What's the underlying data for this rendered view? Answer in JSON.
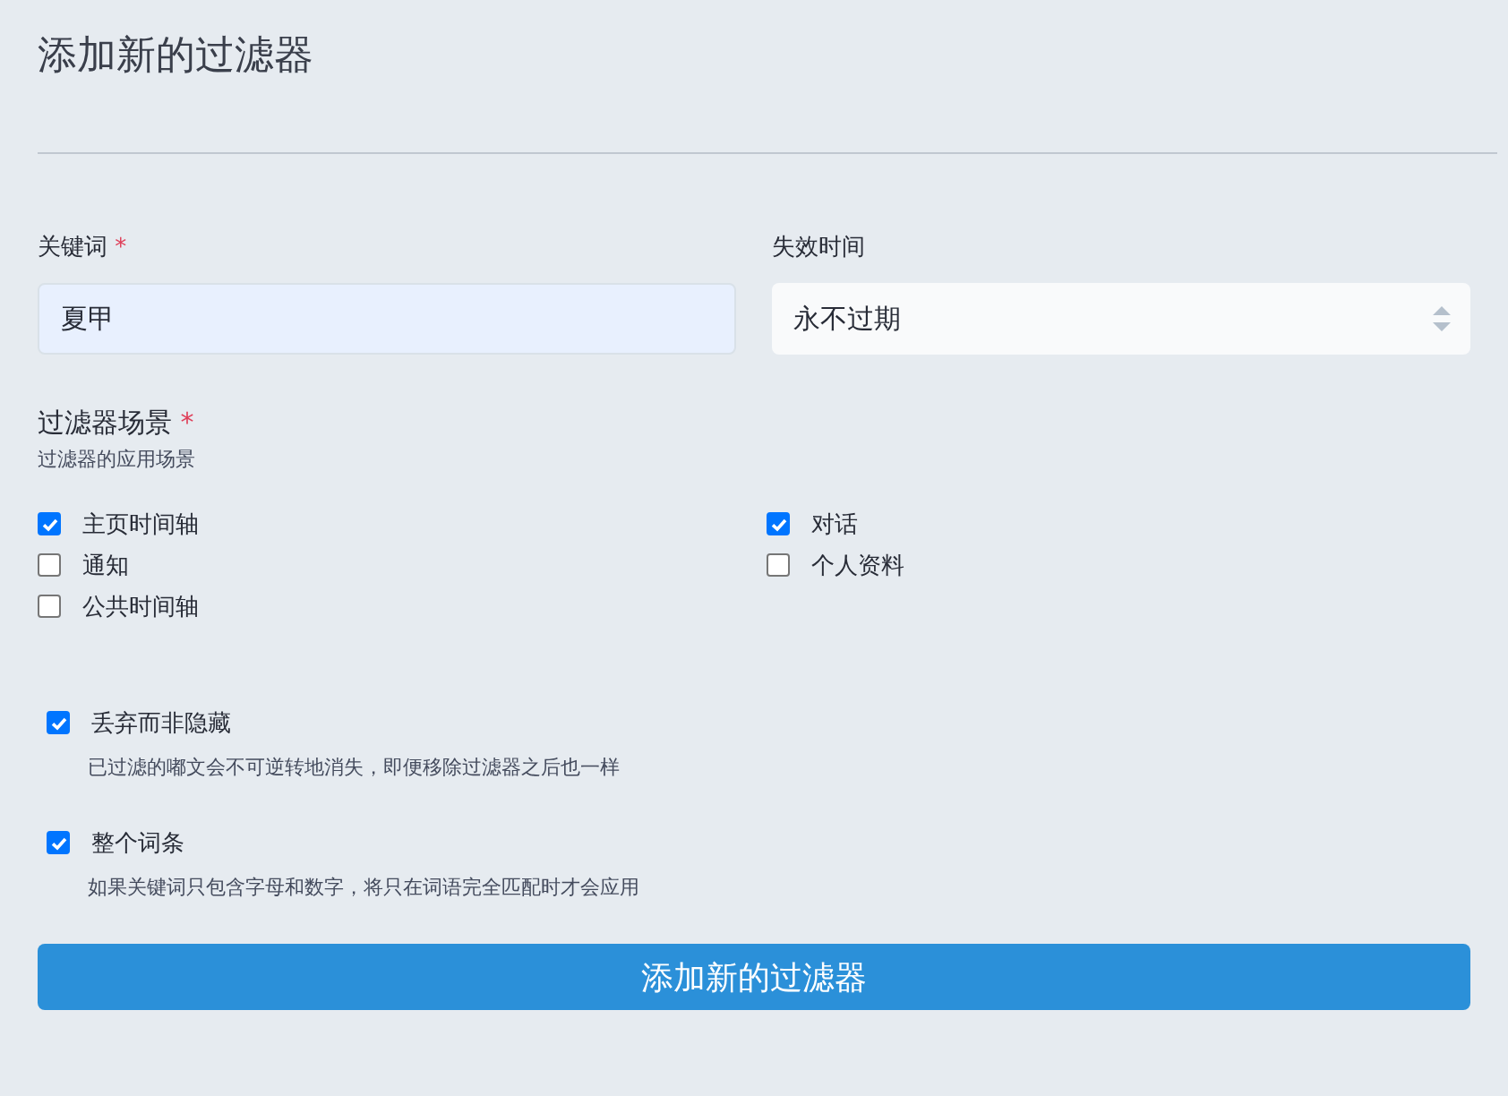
{
  "title": "添加新的过滤器",
  "keyword": {
    "label": "关键词",
    "required_mark": "*",
    "value": "夏甲"
  },
  "expiry": {
    "label": "失效时间",
    "value": "永不过期"
  },
  "context": {
    "label": "过滤器场景",
    "required_mark": "*",
    "hint": "过滤器的应用场景",
    "options": [
      {
        "label": "主页时间轴",
        "checked": true
      },
      {
        "label": "对话",
        "checked": true
      },
      {
        "label": "通知",
        "checked": false
      },
      {
        "label": "个人资料",
        "checked": false
      },
      {
        "label": "公共时间轴",
        "checked": false
      }
    ]
  },
  "options": [
    {
      "label": "丢弃而非隐藏",
      "checked": true,
      "hint": "已过滤的嘟文会不可逆转地消失，即便移除过滤器之后也一样"
    },
    {
      "label": "整个词条",
      "checked": true,
      "hint": "如果关键词只包含字母和数字，将只在词语完全匹配时才会应用"
    }
  ],
  "submit": "添加新的过滤器"
}
